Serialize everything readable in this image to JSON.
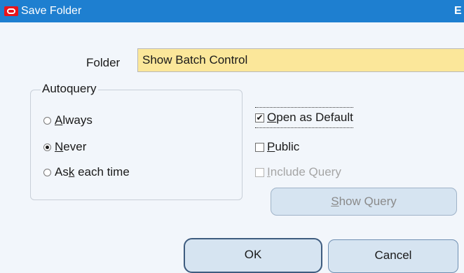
{
  "window": {
    "title": "Save Folder",
    "title_edge_glyph": "E"
  },
  "form": {
    "folder_label": "Folder",
    "folder_value": "Show Batch Control"
  },
  "autoquery": {
    "group_label": "Autoquery",
    "options": [
      {
        "label_pre": "",
        "label_accel": "A",
        "label_post": "lways",
        "selected": false
      },
      {
        "label_pre": "",
        "label_accel": "N",
        "label_post": "ever",
        "selected": true
      },
      {
        "label_pre": "As",
        "label_accel": "k",
        "label_post": " each time",
        "selected": false
      }
    ]
  },
  "options": {
    "open_as_default": {
      "label_pre": "",
      "label_accel": "O",
      "label_post": "pen as Default",
      "checked": true
    },
    "public": {
      "label_pre": "",
      "label_accel": "P",
      "label_post": "ublic",
      "checked": false
    },
    "include_query": {
      "label_pre": "",
      "label_accel": "I",
      "label_post": "nclude Query",
      "checked": false,
      "disabled": true
    }
  },
  "buttons": {
    "show_query": {
      "label_pre": "",
      "label_accel": "S",
      "label_post": "how Query"
    },
    "ok": "OK",
    "cancel": "Cancel"
  },
  "colors": {
    "titlebar": "#1e7fd0",
    "folder_field": "#fbe79a",
    "button_fill": "#d6e4f1"
  }
}
